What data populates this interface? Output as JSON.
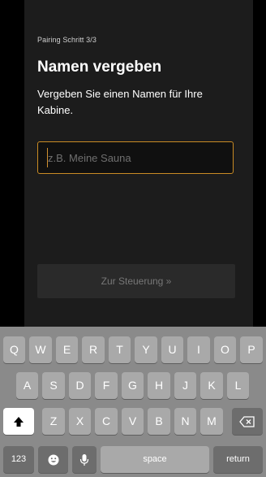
{
  "header": {
    "step": "Pairing Schritt 3/3",
    "title": "Namen vergeben",
    "description": "Vergeben Sie einen Namen für Ihre Kabine."
  },
  "form": {
    "name_placeholder": "z.B. Meine Sauna",
    "name_value": ""
  },
  "actions": {
    "continue_label": "Zur Steuerung »"
  },
  "keyboard": {
    "row1": [
      "Q",
      "W",
      "E",
      "R",
      "T",
      "Y",
      "U",
      "I",
      "O",
      "P"
    ],
    "row2": [
      "A",
      "S",
      "D",
      "F",
      "G",
      "H",
      "J",
      "K",
      "L"
    ],
    "row3": [
      "Z",
      "X",
      "C",
      "V",
      "B",
      "N",
      "M"
    ],
    "numbers": "123",
    "space": "space",
    "return": "return",
    "shift_icon": "shift-arrow-icon",
    "backspace_icon": "backspace-icon",
    "emoji_icon": "emoji-icon",
    "mic_icon": "microphone-icon"
  },
  "colors": {
    "background": "#1c1c1c",
    "accent_border": "#c98b24",
    "keyboard_bg": "#8a8a8a",
    "key_bg": "#a9a9a9"
  }
}
